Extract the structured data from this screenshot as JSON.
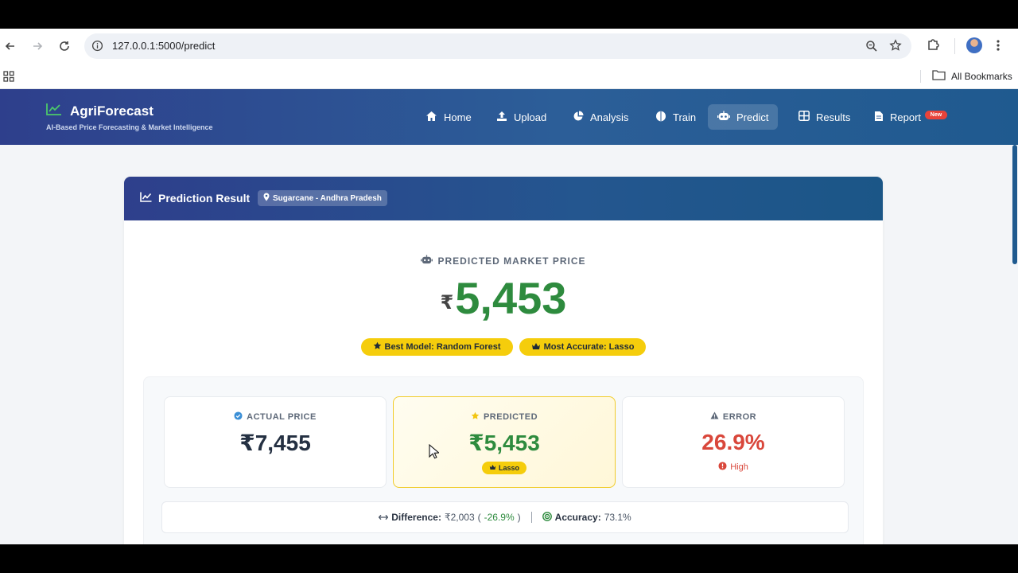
{
  "browser": {
    "url": "127.0.0.1:5000/predict",
    "bookmarks_label": "All Bookmarks",
    "icons": [
      "back-icon",
      "forward-icon",
      "reload-icon",
      "site-info-icon",
      "zoom-icon",
      "bookmark-star-icon",
      "extensions-icon",
      "profile-avatar",
      "menu-icon",
      "apps-grid-icon",
      "folder-icon"
    ]
  },
  "app": {
    "brand_title": "AgriForecast",
    "brand_subtitle": "AI-Based Price Forecasting & Market Intelligence",
    "nav": [
      {
        "label": "Home",
        "icon": "home-icon"
      },
      {
        "label": "Upload",
        "icon": "upload-icon"
      },
      {
        "label": "Analysis",
        "icon": "pie-chart-icon"
      },
      {
        "label": "Train",
        "icon": "brain-icon"
      },
      {
        "label": "Predict",
        "icon": "robot-icon",
        "active": true
      },
      {
        "label": "Results",
        "icon": "table-icon"
      },
      {
        "label": "Report",
        "icon": "file-icon",
        "badge": "New"
      }
    ]
  },
  "result": {
    "header_title": "Prediction Result",
    "location": "Sugarcane - Andhra Pradesh",
    "predicted_label": "PREDICTED MARKET PRICE",
    "currency": "₹",
    "predicted_value": "5,453",
    "best_model": "Best Model: Random Forest",
    "most_accurate": "Most Accurate: Lasso"
  },
  "stats": {
    "actual": {
      "label": "ACTUAL PRICE",
      "value": "₹7,455"
    },
    "predicted": {
      "label": "PREDICTED",
      "value": "₹5,453",
      "badge": "Lasso"
    },
    "error": {
      "label": "ERROR",
      "value": "26.9%",
      "level": "High"
    }
  },
  "summary": {
    "difference_label": "Difference:",
    "difference_value": "₹2,003",
    "paren_open": "(",
    "difference_pct": "-26.9%",
    "paren_close": ")",
    "accuracy_label": "Accuracy:",
    "accuracy_value": "73.1%"
  },
  "colors": {
    "nav_gradient_start": "#2e3f8c",
    "nav_gradient_end": "#1f5a8f",
    "price_green": "#2e8b3e",
    "error_red": "#d9473b",
    "badge_gold": "#f5cd0c",
    "actual_dark": "#243042"
  }
}
